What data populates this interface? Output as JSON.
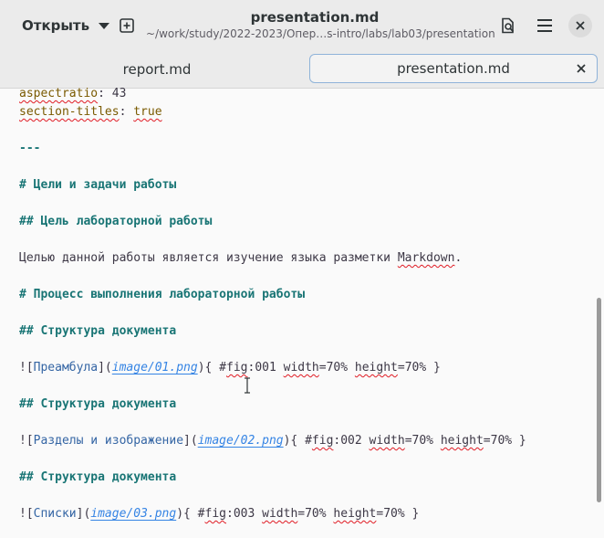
{
  "header": {
    "open_label": "Открыть",
    "title": "presentation.md",
    "subtitle": "~/work/study/2022-2023/Опер…s-intro/labs/lab03/presentation"
  },
  "tabs": [
    {
      "label": "report.md",
      "active": false
    },
    {
      "label": "presentation.md",
      "active": true
    }
  ],
  "editor": {
    "l1": {
      "key": "aspectratio",
      "sep": ": ",
      "val": "43"
    },
    "l2": {
      "key": "section-titles",
      "sep": ": ",
      "val": "true"
    },
    "l3": "---",
    "l4": "# Цели и задачи работы",
    "l5": "## Цель лабораторной работы",
    "l6": {
      "pre": "Целью данной работы является изучение языка разметки ",
      "word": "Markdown",
      "post": "."
    },
    "l7": "# Процесс выполнения лабораторной работы",
    "l8": "## Структура документа",
    "l9": {
      "alt": "Преамбула",
      "url": "image/01.png",
      "fig": "001"
    },
    "l10": "## Структура документа",
    "l11": {
      "alt": "Разделы и изображение",
      "url": "image/02.png",
      "fig": "002"
    },
    "l12": "## Структура документа",
    "l13": {
      "alt": "Списки",
      "url": "image/03.png",
      "fig": "003"
    },
    "attr": {
      "fig_word": "fig",
      "width_word": "width",
      "height_word": "height",
      "pct": "70%"
    }
  },
  "colors": {
    "heading": "#197575",
    "link": "#3584e4",
    "spell": "#e01b24"
  }
}
